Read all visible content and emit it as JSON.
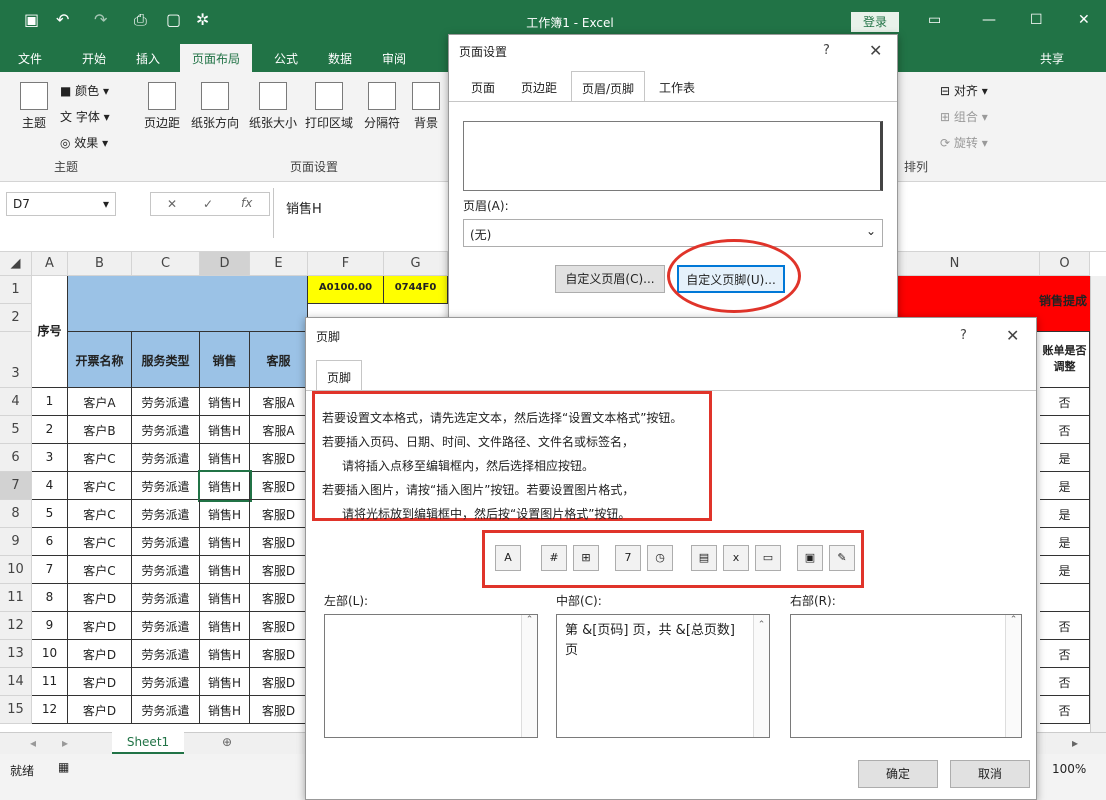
{
  "window": {
    "title": "工作簿1 - Excel",
    "login": "登录",
    "share": "共享"
  },
  "tabs": [
    "文件",
    "开始",
    "插入",
    "页面布局",
    "公式",
    "数据",
    "审阅"
  ],
  "ribbon": {
    "theme": "主题",
    "colors": "颜色",
    "fonts": "字体",
    "effects": "效果",
    "margins": "页边距",
    "orientation": "纸张方向",
    "size": "纸张大小",
    "print_area": "打印区域",
    "breaks": "分隔符",
    "background": "背景",
    "align": "对齐",
    "group": "组合",
    "rotate": "旋转",
    "grp_theme": "主题",
    "grp_setup": "页面设置",
    "grp_arrange": "排列"
  },
  "formula": {
    "namebox": "D7",
    "value": "销售H"
  },
  "sheet": {
    "columns": [
      "A",
      "B",
      "C",
      "D",
      "E",
      "F",
      "G",
      "N",
      "O"
    ],
    "rows": [
      "1",
      "2",
      "3",
      "4",
      "5",
      "6",
      "7",
      "8",
      "9",
      "10",
      "11",
      "12",
      "13",
      "14",
      "15"
    ],
    "headers": {
      "a": "序号",
      "b": "开票名称",
      "c": "服务类型",
      "d": "销售",
      "e": "客服",
      "n": "销售提成",
      "o1": "账单是否",
      "o2": "调整"
    },
    "f1": "A0100.00",
    "g1": "0744F0",
    "data": [
      {
        "a": "1",
        "b": "客户A",
        "c": "劳务派遣",
        "d": "销售H",
        "e": "客服A",
        "o": "否"
      },
      {
        "a": "2",
        "b": "客户B",
        "c": "劳务派遣",
        "d": "销售H",
        "e": "客服A",
        "o": "否"
      },
      {
        "a": "3",
        "b": "客户C",
        "c": "劳务派遣",
        "d": "销售H",
        "e": "客服D",
        "o": "是"
      },
      {
        "a": "4",
        "b": "客户C",
        "c": "劳务派遣",
        "d": "销售H",
        "e": "客服D",
        "o": "是"
      },
      {
        "a": "5",
        "b": "客户C",
        "c": "劳务派遣",
        "d": "销售H",
        "e": "客服D",
        "o": "是"
      },
      {
        "a": "6",
        "b": "客户C",
        "c": "劳务派遣",
        "d": "销售H",
        "e": "客服D",
        "o": "是"
      },
      {
        "a": "7",
        "b": "客户C",
        "c": "劳务派遣",
        "d": "销售H",
        "e": "客服D",
        "o": "是"
      },
      {
        "a": "8",
        "b": "客户D",
        "c": "劳务派遣",
        "d": "销售H",
        "e": "客服D",
        "o": ""
      },
      {
        "a": "9",
        "b": "客户D",
        "c": "劳务派遣",
        "d": "销售H",
        "e": "客服D",
        "o": "否"
      },
      {
        "a": "10",
        "b": "客户D",
        "c": "劳务派遣",
        "d": "销售H",
        "e": "客服D",
        "o": "否"
      },
      {
        "a": "11",
        "b": "客户D",
        "c": "劳务派遣",
        "d": "销售H",
        "e": "客服D",
        "o": "否"
      },
      {
        "a": "12",
        "b": "客户D",
        "c": "劳务派遣",
        "d": "销售H",
        "e": "客服D",
        "o": "否"
      }
    ],
    "tab": "Sheet1"
  },
  "status": {
    "ready": "就绪",
    "zoom": "100%"
  },
  "page_setup": {
    "title": "页面设置",
    "tabs": [
      "页面",
      "页边距",
      "页眉/页脚",
      "工作表"
    ],
    "header_label": "页眉(A):",
    "header_value": "(无)",
    "custom_header": "自定义页眉(C)...",
    "custom_footer": "自定义页脚(U)..."
  },
  "footer_dialog": {
    "title": "页脚",
    "tab": "页脚",
    "instructions": [
      "若要设置文本格式，请先选定文本，然后选择“设置文本格式”按钮。",
      "若要插入页码、日期、时间、文件路径、文件名或标签名，",
      "请将插入点移至编辑框内，然后选择相应按钮。",
      "若要插入图片，请按“插入图片”按钮。若要设置图片格式，",
      "请将光标放到编辑框中，然后按“设置图片格式”按钮。"
    ],
    "left_label": "左部(L):",
    "center_label": "中部(C):",
    "right_label": "右部(R):",
    "center_text": "第 &[页码] 页，共 &[总页数] 页",
    "ok": "确定",
    "cancel": "取消"
  },
  "colors": {
    "excel_green": "#217346",
    "header_blue": "#9bc2e6",
    "red": "#ff0000",
    "yellow": "#ffff00",
    "highlight": "#e0342a"
  }
}
